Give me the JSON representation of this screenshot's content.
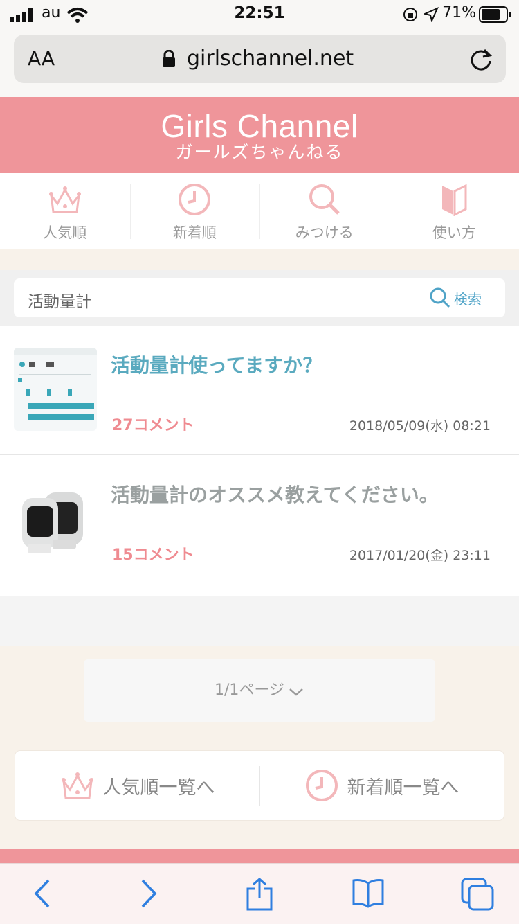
{
  "status_bar": {
    "carrier": "au",
    "time": "22:51",
    "battery": "71%"
  },
  "browser": {
    "text_size": "AA",
    "url": "girlschannel.net"
  },
  "site": {
    "logo": "Girls Channel",
    "logo_sub": "ガールズちゃんねる",
    "brand_color": "#ef959a"
  },
  "nav": {
    "items": [
      {
        "label": "人気順",
        "icon": "crown-icon"
      },
      {
        "label": "新着順",
        "icon": "clock-icon"
      },
      {
        "label": "みつける",
        "icon": "search-icon"
      },
      {
        "label": "使い方",
        "icon": "book-icon"
      }
    ]
  },
  "search": {
    "query": "活動量計",
    "button": "検索"
  },
  "results": [
    {
      "title": "活動量計使ってますか？",
      "comments": "27コメント",
      "date": "2018/05/09(水) 08:21",
      "title_color": "#5aaabf"
    },
    {
      "title": "活動量計のオススメ教えてください。",
      "comments": "15コメント",
      "date": "2017/01/20(金) 23:11",
      "title_color": "#9aa0a0"
    }
  ],
  "pager": {
    "label": "1/1ページ"
  },
  "bottom_nav": {
    "popular": "人気順一覧へ",
    "newest": "新着順一覧へ"
  }
}
